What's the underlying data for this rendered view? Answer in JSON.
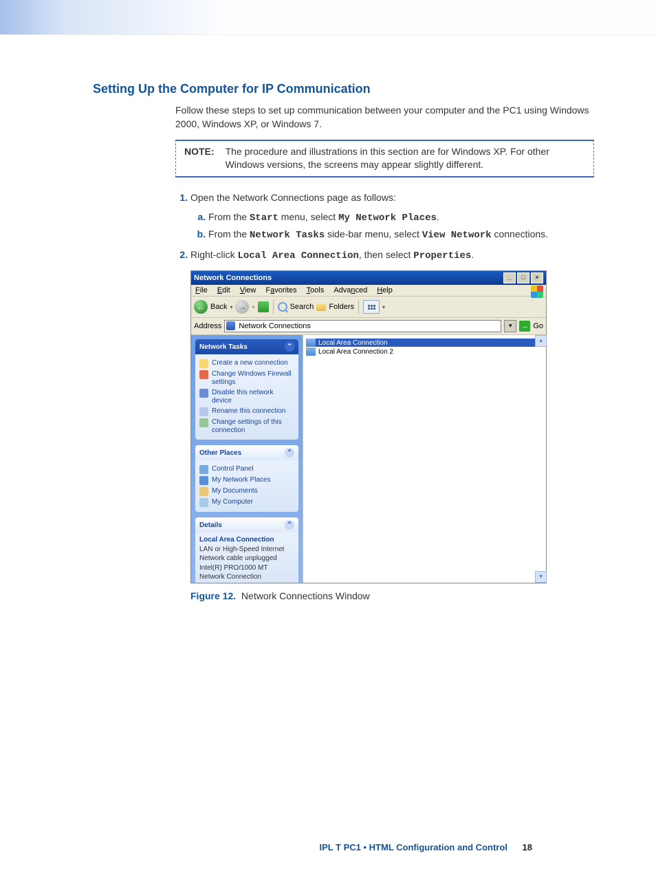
{
  "heading": "Setting Up the Computer for IP Communication",
  "intro": "Follow these steps to set up communication between your computer and the PC1 using Windows 2000, Windows XP, or Windows 7.",
  "note": {
    "label": "NOTE:",
    "text": "The procedure and illustrations in this section are for Windows XP. For other Windows versions, the screens may appear slightly different."
  },
  "step1": {
    "text": "Open the Network Connections page as follows:",
    "a_pre": "From the ",
    "a_code1": "Start",
    "a_mid": " menu, select ",
    "a_code2": "My Network Places",
    "a_post": ".",
    "b_pre": "From the ",
    "b_code1": "Network Tasks",
    "b_mid": " side-bar menu, select ",
    "b_code2": "View Network",
    "b_post": " connections."
  },
  "step2": {
    "pre": "Right-click ",
    "code1": "Local Area Connection",
    "mid": ", then select ",
    "code2": "Properties",
    "post": "."
  },
  "win": {
    "title": "Network Connections",
    "menu": [
      "File",
      "Edit",
      "View",
      "Favorites",
      "Tools",
      "Advanced",
      "Help"
    ],
    "toolbar": {
      "back": "Back",
      "search": "Search",
      "folders": "Folders"
    },
    "addr": {
      "label": "Address",
      "value": "Network Connections",
      "go": "Go"
    },
    "side": {
      "tasks": {
        "title": "Network Tasks",
        "items": [
          "Create a new connection",
          "Change Windows Firewall settings",
          "Disable this network device",
          "Rename this connection",
          "Change settings of this connection"
        ]
      },
      "places": {
        "title": "Other Places",
        "items": [
          "Control Panel",
          "My Network Places",
          "My Documents",
          "My Computer"
        ]
      },
      "details": {
        "title": "Details",
        "name": "Local Area Connection",
        "lines": [
          "LAN or High-Speed Internet",
          "Network cable unplugged",
          "Intel(R) PRO/1000 MT Network Connection"
        ]
      }
    },
    "main": {
      "item1": "Local Area Connection",
      "item2": "Local Area Connection 2"
    }
  },
  "caption": {
    "num": "Figure 12.",
    "text": "Network Connections Window"
  },
  "footer": {
    "text": "IPL T PC1 • HTML Configuration and Control",
    "page": "18"
  }
}
